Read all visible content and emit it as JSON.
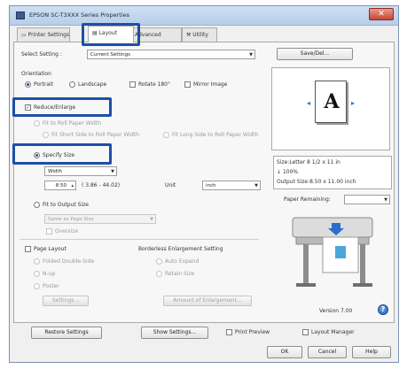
{
  "window": {
    "title": "EPSON SC-T3XXX Series Properties",
    "close_glyph": "✕"
  },
  "tabs": [
    {
      "label": "Printer Settings"
    },
    {
      "label": "Layout"
    },
    {
      "label": "Advanced"
    },
    {
      "label": "Utility"
    }
  ],
  "select_setting": {
    "label": "Select Setting :",
    "value": "Current Settings",
    "save_del": "Save/Del..."
  },
  "orientation": {
    "label": "Orientation",
    "portrait": "Portrait",
    "landscape": "Landscape",
    "rotate": "Rotate 180°",
    "mirror": "Mirror Image"
  },
  "reduce_enlarge": {
    "label": "Reduce/Enlarge",
    "fit_width": "Fit to Roll Paper Width",
    "fit_short": "Fit Short Side to Roll Paper Width",
    "fit_long": "Fit Long Side to Roll Paper Width",
    "specify_size": "Specify Size",
    "unit_select": "Width",
    "value": "8.50",
    "range": "( 3.86 - 44.02)",
    "unit_label": "Unit",
    "unit_value": "inch"
  },
  "output_size": {
    "label": "Fit to Output Size",
    "select": "Same as Page Size",
    "oversize": "Oversize"
  },
  "page_layout": {
    "label": "Page Layout",
    "folded": "Folded Double-Side",
    "nup": "N-up",
    "poster": "Poster",
    "settings": "Settings..."
  },
  "borderless": {
    "label": "Borderless Enlargement Setting",
    "auto": "Auto Expand",
    "retain": "Retain Size",
    "amount": "Amount of Enlargement..."
  },
  "preview": {
    "glyph": "A",
    "size_line": "Size:Letter 8 1/2 x 11 in",
    "percent": "100%",
    "output_line": "Output Size:8.50 x 11.00 inch",
    "paper_remaining": "Paper Remaining:",
    "version": "Version 7.00",
    "help_glyph": "?"
  },
  "bottom": {
    "restore": "Restore Settings",
    "show_settings": "Show Settings...",
    "print_preview": "Print Preview",
    "layout_manager": "Layout Manager",
    "ok": "OK",
    "cancel": "Cancel",
    "help": "Help"
  }
}
